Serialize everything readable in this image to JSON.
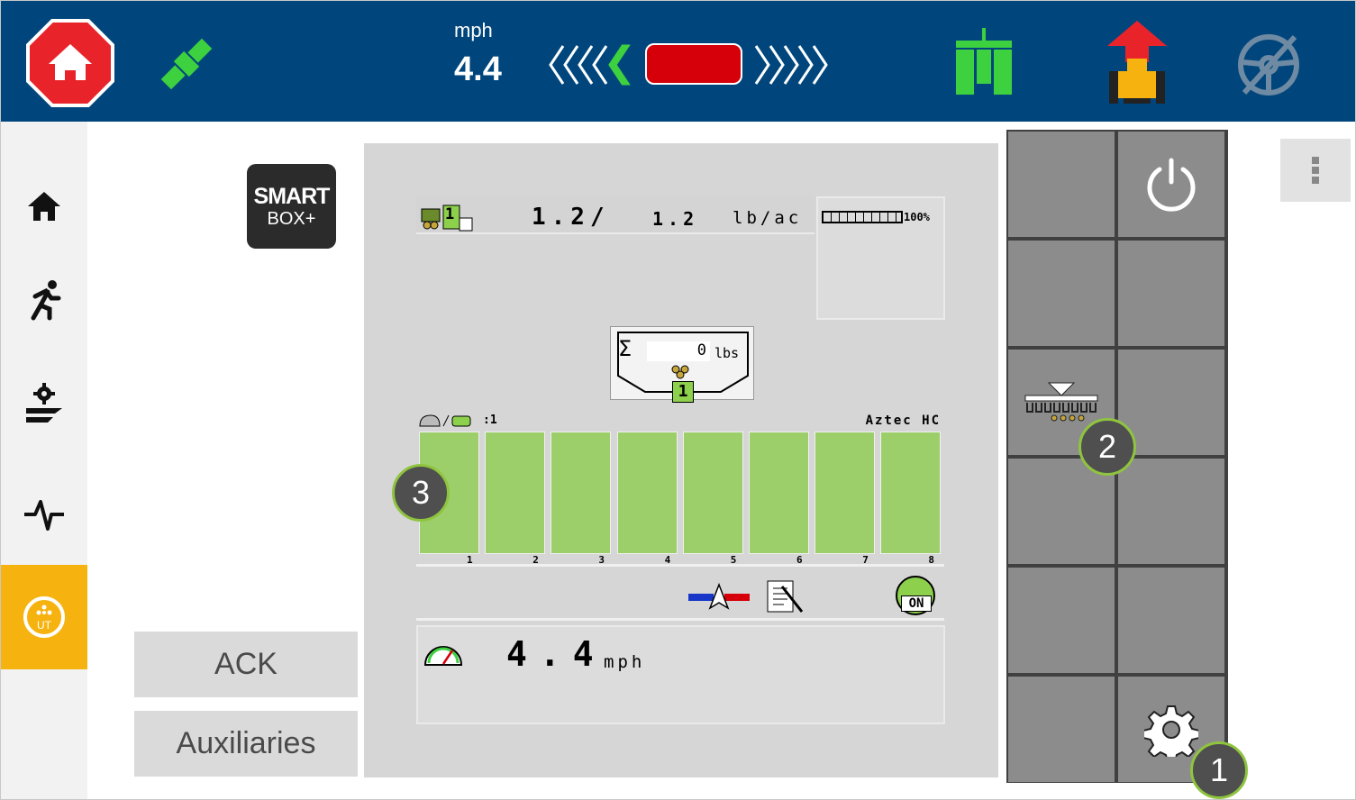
{
  "topbar": {
    "speed_unit": "mph",
    "speed_value": "4.4",
    "icons": [
      "home-stop-icon",
      "gps-satellite-icon",
      "lightbar-left-chevrons-icon",
      "lightbar-right-chevrons-icon",
      "section-control-icon",
      "tractor-icon",
      "steering-disabled-icon"
    ],
    "colors": {
      "bar": "#00467c",
      "stop": "#e8242a",
      "gps": "#3dd13f",
      "lightbar": "#d6000a"
    }
  },
  "sidebar": {
    "items": [
      {
        "name": "home",
        "icon": "home-icon"
      },
      {
        "name": "run",
        "icon": "runner-icon"
      },
      {
        "name": "field-setup",
        "icon": "field-gear-icon"
      },
      {
        "name": "diagnostics",
        "icon": "pulse-icon"
      },
      {
        "name": "universal-terminal",
        "icon": "ut-icon",
        "active": true
      }
    ],
    "active_color": "#f6b30f"
  },
  "logo": {
    "line1": "SMART",
    "line2": "BOX+"
  },
  "buttons": {
    "ack": "ACK",
    "auxiliaries": "Auxiliaries"
  },
  "mask": {
    "product_number": "1",
    "rate_actual": "1.2/",
    "rate_target": "1.2",
    "rate_unit": "lb/ac",
    "bin_level": "100%",
    "bin_fraction": 1.0,
    "total_label": "Σ",
    "total_value": "0",
    "total_unit": "lbs",
    "total_product": "1",
    "row_ratio": ":1",
    "product_name": "Aztec HC",
    "sections": [
      "1",
      "2",
      "3",
      "4",
      "5",
      "6",
      "7",
      "8"
    ],
    "section_color": "#9ccf6a",
    "status_on": "ON",
    "speed_value": "4.4",
    "speed_unit": "mph"
  },
  "softkeys": {
    "icons": [
      "power-icon",
      "planter-icon",
      "gear-icon"
    ]
  },
  "callouts": [
    "1",
    "2",
    "3"
  ]
}
